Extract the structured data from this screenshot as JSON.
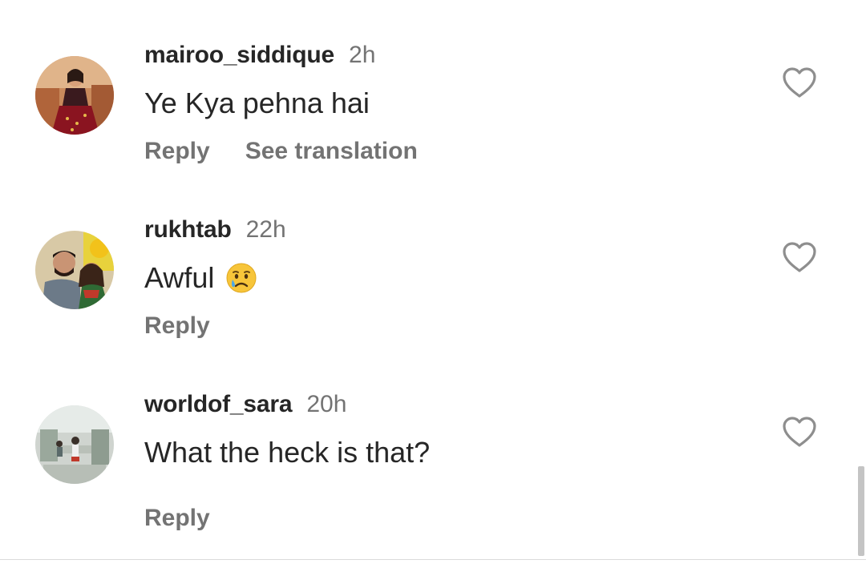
{
  "comments": [
    {
      "username": "mairoo_siddique",
      "time": "2h",
      "text": "Ye Kya pehna hai",
      "reply_label": "Reply",
      "translate_label": "See translation",
      "avatar_icon": "avatar-woman-red-dress",
      "like_icon": "heart-outline-icon"
    },
    {
      "username": "rukhtab",
      "time": "22h",
      "text": "Awful",
      "emoji": "crying-face-emoji",
      "reply_label": "Reply",
      "avatar_icon": "avatar-couple-selfie",
      "like_icon": "heart-outline-icon"
    },
    {
      "username": "worldof_sara",
      "time": "20h",
      "text": "What the heck is that?",
      "reply_label": "Reply",
      "avatar_icon": "avatar-room-scene",
      "like_icon": "heart-outline-icon"
    }
  ],
  "colors": {
    "primary_text": "#262626",
    "secondary_text": "#737373",
    "background": "#ffffff"
  }
}
